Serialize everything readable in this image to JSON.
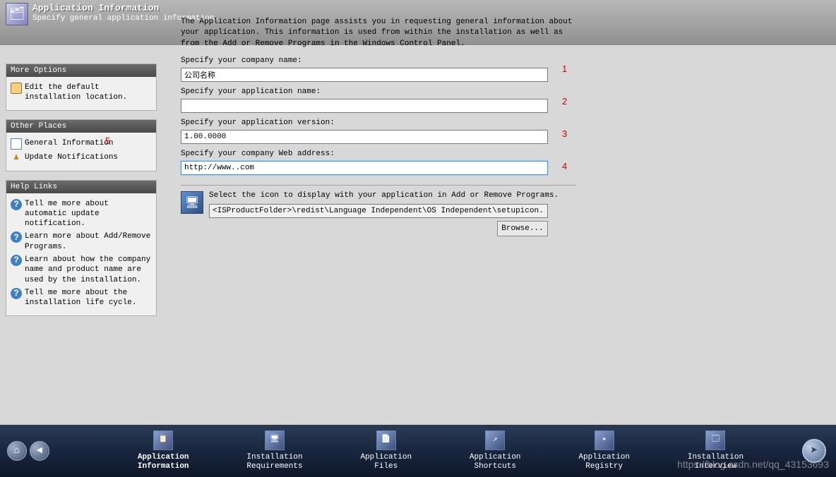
{
  "header": {
    "title": "Application Information",
    "subtitle": "Specify general application information."
  },
  "more_options": {
    "title": "More Options",
    "items": [
      "Edit the default installation location."
    ]
  },
  "other_places": {
    "title": "Other Places",
    "items": [
      "General Information",
      "Update Notifications"
    ]
  },
  "help_links": {
    "title": "Help Links",
    "items": [
      "Tell me more about automatic update notification.",
      "Learn more about Add/Remove Programs.",
      "Learn about how the company name and product name are used by the installation.",
      "Tell me more about the installation life cycle."
    ]
  },
  "main": {
    "desc": "The Application Information page assists you in requesting general information about your application. This information is used from within the installation as well as from the Add or Remove Programs in the Windows Control Panel.",
    "company_label": "Specify your company name:",
    "company_value": "公司名称",
    "app_label": "Specify your application name:",
    "app_value": "",
    "version_label": "Specify your application version:",
    "version_value": "1.00.0000",
    "web_label": "Specify your company Web address:",
    "web_value": "http://www..com",
    "icon_label": "Select the icon to display with your application in Add or Remove Programs.",
    "icon_path": "<ISProductFolder>\\redist\\Language Independent\\OS Independent\\setupicon.ico",
    "browse": "Browse..."
  },
  "annotations": {
    "a1": "1",
    "a2": "2",
    "a3": "3",
    "a4": "4",
    "a5": "5"
  },
  "nav": {
    "items": [
      "Application\nInformation",
      "Installation\nRequirements",
      "Application\nFiles",
      "Application\nShortcuts",
      "Application\nRegistry",
      "Installation\nInterview"
    ]
  },
  "watermark": "https://blog.csdn.net/qq_43153693"
}
